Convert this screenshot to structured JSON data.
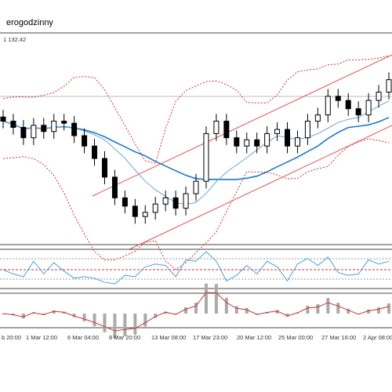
{
  "header": {
    "title": "erogodzinny",
    "info": "1 132.42"
  },
  "chart_data": {
    "type": "candlestick",
    "x_tick_labels": [
      "b 20:00",
      "1 Mar 12:00",
      "6 Mar 04:00",
      "8 Mar 20:00",
      "13 Mar 08:00",
      "17 Mar 23:00",
      "20 Mar 12:00",
      "25 Mar 00:00",
      "27 Mar 16:00",
      "2 Apr 08:00"
    ],
    "series_main": [
      {
        "name": "candles",
        "color": "#000000"
      },
      {
        "name": "moving-average-slow",
        "color": "#1f77c8"
      },
      {
        "name": "moving-average-fast",
        "color": "#6aa6d8"
      },
      {
        "name": "bollinger-bands",
        "color": "#cc3333",
        "style": "dotted"
      },
      {
        "name": "regression-channel",
        "color": "#e05050"
      }
    ],
    "closes": [
      132.0,
      131.7,
      131.2,
      131.8,
      131.5,
      132.0,
      131.9,
      131.3,
      130.8,
      130.2,
      129.3,
      128.3,
      127.9,
      127.4,
      127.6,
      128.0,
      128.3,
      127.8,
      128.5,
      129.1,
      131.4,
      132.0,
      131.2,
      130.8,
      131.1,
      130.8,
      131.4,
      131.6,
      130.8,
      131.2,
      132.0,
      132.3,
      133.2,
      133.0,
      132.6,
      132.3,
      133.0,
      133.4,
      134.0
    ],
    "oscillator": {
      "color": "#4aa0dc",
      "reference_line_color": "#cc3333"
    },
    "histogram": {
      "bar_color": "#aaaaaa",
      "signal_color": "#cc3333"
    },
    "grid": false,
    "colors": {
      "accent_red": "#cc3333",
      "accent_blue": "#1f77c8",
      "panel_border": "#444444"
    }
  }
}
